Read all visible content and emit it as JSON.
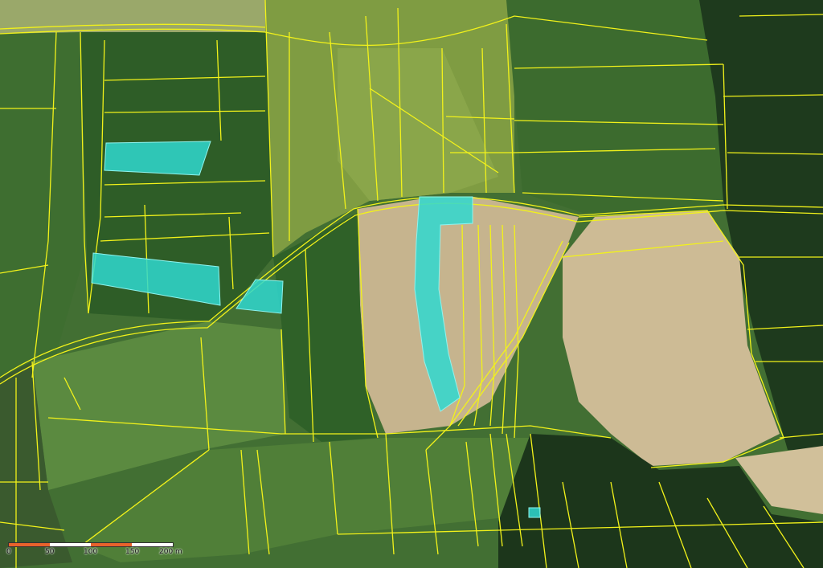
{
  "map": {
    "imagery": "orthophoto",
    "colors": {
      "parcel_outline": "#f2f21a",
      "highlight_fill": "#2fd8d0",
      "meadow_dark": "#2f5f2a",
      "meadow": "#4a7a36",
      "crop_light": "#7e9a3c",
      "field_bare": "#cbb992",
      "forest": "#1f3a1e"
    },
    "highlighted_parcels": 6
  },
  "scale_bar": {
    "labels": [
      "0",
      "50",
      "100",
      "150",
      "200 m"
    ],
    "colors": [
      "#e8622c",
      "#ffffff",
      "#e8622c",
      "#ffffff"
    ]
  }
}
